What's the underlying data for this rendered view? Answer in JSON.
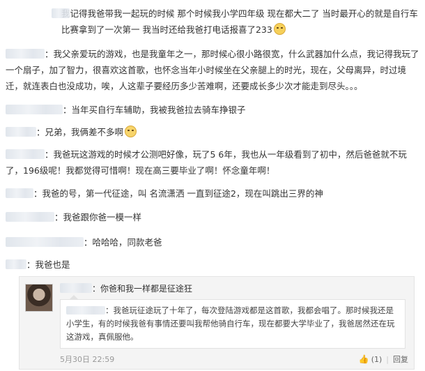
{
  "comments": [
    {
      "text": "我记得我爸带我一起玩的时候 那个时候我小学四年级 现在都大二了 当时最开心的就是自行车比赛拿到了一次第一 我当时还给我爸打电话报喜了233"
    },
    {
      "text": "：我父亲爱玩的游戏，也是我童年之一，那时候心很小路很宽，什么武器加什么点，我记得我玩了一个扇子，加了智力，很喜欢这首歌，也怀念当年小时候坐在父亲腿上的时光，现在，父母离异，时过境迁，就连表白也没成功，唉，人这辈子要经历多少苦难啊，还要成长多少次才能走到尽头。。。"
    },
    {
      "text": "：当年买自行车辅助，我被我爸拉去骑车挣银子"
    },
    {
      "text": "：兄弟，我俩差不多啊"
    },
    {
      "text": "：我爸玩这游戏的时候才公测吧好像，玩了5 6年，我也从一年级看到了初中，然后爸爸就不玩了，196级呢！我都觉得可惜啊！现在高三要毕业了啊！怀念童年啊！"
    },
    {
      "text": "：我爸的号，第一代征途，叫 名流潇洒 一直到征途2，现在叫跳出三界的神"
    },
    {
      "text": "：我爸跟你爸一模一样"
    },
    {
      "text": "：哈哈哈，同款老爸"
    },
    {
      "text": "：我爸也是"
    }
  ],
  "reply": {
    "head": "：你爸和我一样都是征途狂",
    "quote": "：我爸玩征途玩了十年了，每次登陆游戏都是这首歌，我都会唱了。那时候我还是小学生，有的时候我爸有事情还要叫我帮他骑自行车，现在都要大学毕业了，我爸居然还在玩这游戏，真佩服他。",
    "time": "5月30日 22:59",
    "like_count": "(1)",
    "reply_label": "回复"
  }
}
